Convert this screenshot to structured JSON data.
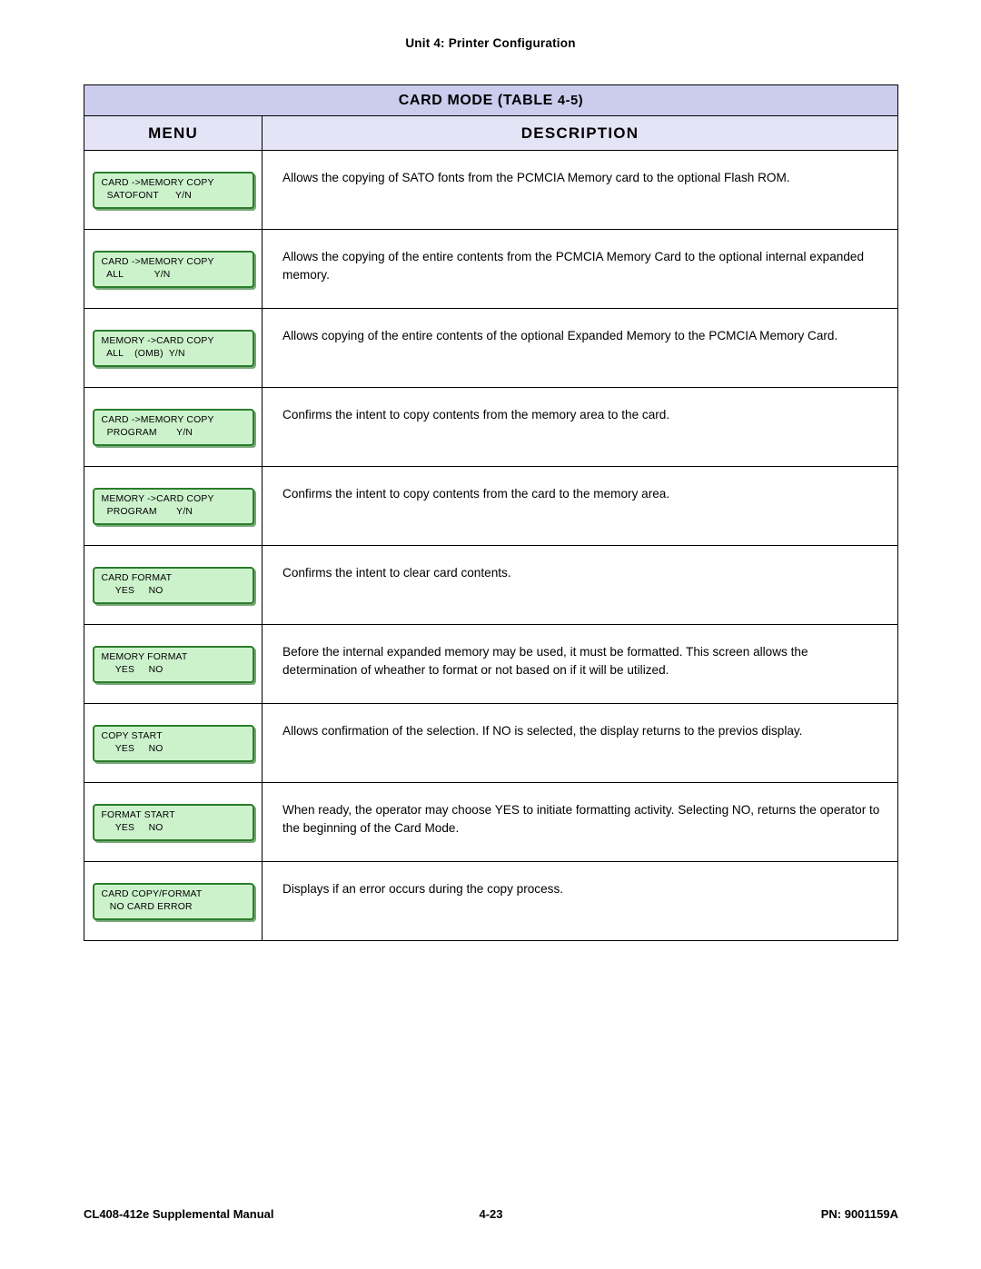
{
  "header": {
    "unit_title": "Unit 4:  Printer Configuration"
  },
  "table": {
    "title_main": "CARD MODE (TABLE",
    "title_number": "4-5)",
    "columns": {
      "menu": "MENU",
      "description": "DESCRIPTION"
    },
    "rows": [
      {
        "lcd_line1": "CARD ->MEMORY COPY",
        "lcd_line2": "  SATOFONT      Y/N",
        "description": "Allows the copying of SATO fonts from the PCMCIA Memory card to the optional Flash ROM."
      },
      {
        "lcd_line1": "CARD ->MEMORY COPY",
        "lcd_line2": "  ALL           Y/N",
        "description": "Allows the copying of the entire contents from the PCMCIA Memory Card to the optional internal expanded memory."
      },
      {
        "lcd_line1": "MEMORY ->CARD COPY",
        "lcd_line2": "  ALL    (OMB)  Y/N",
        "description": "Allows copying of the entire contents of the optional Expanded Memory to the PCMCIA Memory Card."
      },
      {
        "lcd_line1": "CARD ->MEMORY COPY",
        "lcd_line2": "  PROGRAM       Y/N",
        "description": "Confirms the intent to copy contents from the memory area to the card."
      },
      {
        "lcd_line1": "MEMORY ->CARD COPY",
        "lcd_line2": "  PROGRAM       Y/N",
        "description": "Confirms the intent to copy contents from the card to the memory area."
      },
      {
        "lcd_line1": "CARD FORMAT",
        "lcd_line2": "     YES     NO",
        "description": "Confirms the intent to clear card contents."
      },
      {
        "lcd_line1": "MEMORY FORMAT",
        "lcd_line2": "     YES     NO",
        "description": "Before the internal expanded memory may be used, it must be formatted. This screen allows the determination of wheather to format or not based on if it will be utilized."
      },
      {
        "lcd_line1": "COPY START",
        "lcd_line2": "     YES     NO",
        "description": "Allows confirmation of the selection. If NO is selected, the display returns to the previos display."
      },
      {
        "lcd_line1": "FORMAT START",
        "lcd_line2": "     YES     NO",
        "description": "When ready, the operator may choose YES to initiate formatting activity. Selecting NO, returns the operator to the beginning of the Card Mode."
      },
      {
        "lcd_line1": "CARD COPY/FORMAT",
        "lcd_line2": "   NO CARD ERROR",
        "description": "Displays if an error occurs during the copy process."
      }
    ]
  },
  "footer": {
    "left": "CL408-412e Supplemental Manual",
    "center": "4-23",
    "right": "PN: 9001159A"
  }
}
